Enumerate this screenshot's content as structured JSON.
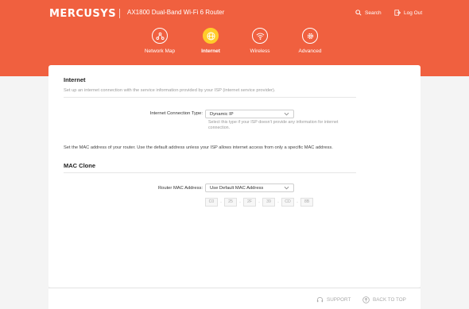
{
  "header": {
    "brand": "MERCUSYS",
    "model": "AX1800 Dual-Band Wi-Fi 6 Router",
    "search_label": "Search",
    "logout_label": "Log Out"
  },
  "nav": {
    "items": [
      {
        "label": "Network Map",
        "icon": "network-map-icon"
      },
      {
        "label": "Internet",
        "icon": "globe-icon",
        "active": true
      },
      {
        "label": "Wireless",
        "icon": "wifi-icon"
      },
      {
        "label": "Advanced",
        "icon": "gear-icon"
      }
    ]
  },
  "internet": {
    "title": "Internet",
    "description": "Set up an internet connection with the service information provided by your ISP (internet service provider).",
    "connection_type_label": "Internet Connection Type:",
    "connection_type_value": "Dynamic IP",
    "connection_hint": "Select this type if your ISP doesn't provide any information for internet connection."
  },
  "mac_clone": {
    "note": "Set the MAC address of your router. Use the default address unless your ISP allows internet access from only a specific MAC address.",
    "title": "MAC Clone",
    "router_mac_label": "Router MAC Address:",
    "router_mac_value": "Use Default MAC Address",
    "mac_octets": [
      "C0",
      "25",
      "2F",
      "39",
      "CD",
      "8B"
    ]
  },
  "footer": {
    "support_label": "SUPPORT",
    "back_to_top_label": "BACK TO TOP"
  },
  "colors": {
    "header_bg": "#f0603f",
    "active_nav": "#ffcc2a"
  }
}
